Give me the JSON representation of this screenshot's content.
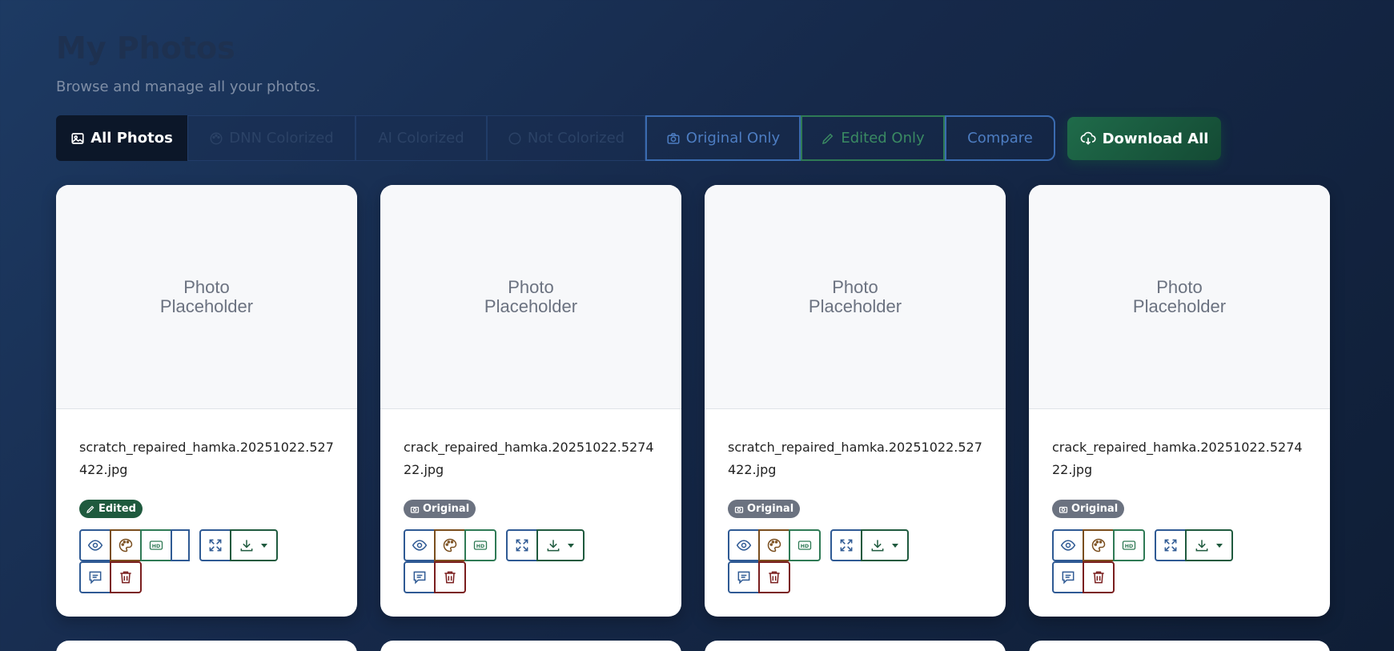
{
  "header": {
    "title": "My Photos",
    "subtitle": "Browse and manage all your photos."
  },
  "filters": [
    {
      "label": "All Photos",
      "icon": "image-icon",
      "active": true
    },
    {
      "label": "DNN Colorized",
      "icon": "palette-icon",
      "active": false
    },
    {
      "label": "AI Colorized",
      "icon": "",
      "active": false
    },
    {
      "label": "Not Colorized",
      "icon": "circle-icon",
      "active": false
    },
    {
      "label": "Original Only",
      "icon": "camera-icon",
      "active": false
    },
    {
      "label": "Edited Only",
      "icon": "pencil-icon",
      "active": false
    },
    {
      "label": "Compare",
      "icon": "",
      "active": false
    }
  ],
  "download_all": {
    "label": "Download All",
    "icon": "cloud-download-icon"
  },
  "placeholder": {
    "line1": "Photo",
    "line2": "Placeholder"
  },
  "cards": [
    {
      "filename": "scratch_repaired_hamka.20251022.527422.jpg",
      "badge": "Edited",
      "badge_type": "edited"
    },
    {
      "filename": "crack_repaired_hamka.20251022.527422.jpg",
      "badge": "Original",
      "badge_type": "original"
    },
    {
      "filename": "scratch_repaired_hamka.20251022.527422.jpg",
      "badge": "Original",
      "badge_type": "original"
    },
    {
      "filename": "crack_repaired_hamka.20251022.527422.jpg",
      "badge": "Original",
      "badge_type": "original"
    }
  ],
  "colors": {
    "accent_blue": "#2f5a94",
    "accent_green": "#1f5a3e",
    "accent_brown": "#7a4e1e",
    "accent_red": "#7a1e1e"
  }
}
